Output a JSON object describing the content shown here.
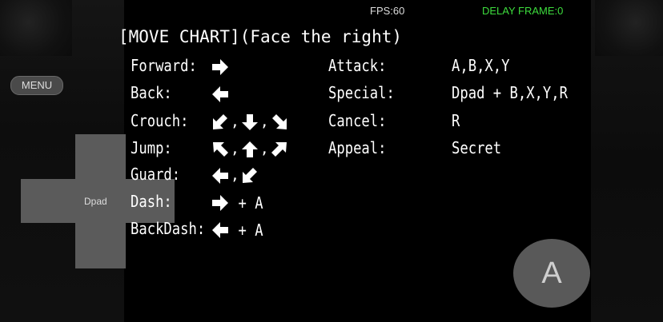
{
  "hud": {
    "fps": "FPS:60",
    "delay": "DELAY FRAME:0",
    "menu_label": "MENU",
    "dpad_label": "Dpad",
    "a_button_label": "A"
  },
  "move_chart": {
    "title": "[MOVE CHART](Face the right)",
    "left_moves": [
      {
        "label": "Forward:",
        "inputs": [
          "right-arrow-icon"
        ],
        "suffix": ""
      },
      {
        "label": "Back:",
        "inputs": [
          "left-arrow-icon"
        ],
        "suffix": ""
      },
      {
        "label": "Crouch:",
        "inputs": [
          "down-left-arrow-icon",
          "down-arrow-icon",
          "down-right-arrow-icon"
        ],
        "suffix": ""
      },
      {
        "label": "Jump:",
        "inputs": [
          "up-left-arrow-icon",
          "up-arrow-icon",
          "up-right-arrow-icon"
        ],
        "suffix": ""
      },
      {
        "label": "Guard:",
        "inputs": [
          "left-arrow-icon",
          "down-left-arrow-icon"
        ],
        "suffix": ""
      },
      {
        "label": "Dash:",
        "inputs": [
          "right-arrow-icon"
        ],
        "suffix": "+ A"
      },
      {
        "label": "BackDash:",
        "inputs": [
          "left-arrow-icon"
        ],
        "suffix": "+ A"
      }
    ],
    "right_moves": [
      {
        "label": "Attack:",
        "value": "A,B,X,Y"
      },
      {
        "label": "Special:",
        "value": "Dpad + B,X,Y,R"
      },
      {
        "label": "Cancel:",
        "value": "R"
      },
      {
        "label": "Appeal:",
        "value": "Secret"
      }
    ],
    "separator": ","
  }
}
